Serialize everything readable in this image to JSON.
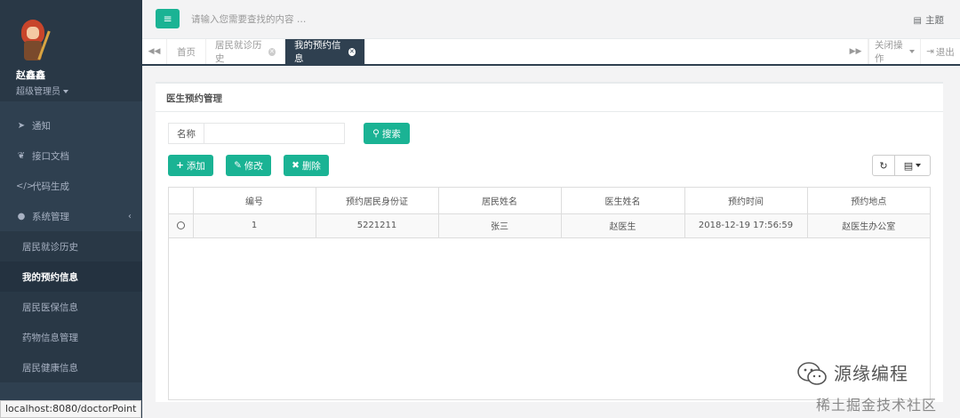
{
  "sidebar": {
    "profile": {
      "name": "赵鑫鑫",
      "role": "超级管理员"
    },
    "items": [
      {
        "icon": "paper-plane-icon",
        "glyph": "➤",
        "label": "通知"
      },
      {
        "icon": "leaf-icon",
        "glyph": "❦",
        "label": "接口文档"
      },
      {
        "icon": "code-icon",
        "glyph": "</>",
        "label": "代码生成"
      },
      {
        "icon": "user-icon",
        "glyph": "●",
        "label": "系统管理",
        "arrow": "‹"
      }
    ],
    "subitems": [
      "居民就诊历史",
      "我的预约信息",
      "居民医保信息",
      "药物信息管理",
      "居民健康信息"
    ],
    "active_sub": "我的预约信息"
  },
  "statusbar": {
    "url": "localhost:8080/doctorPoint"
  },
  "topbar": {
    "menu_icon": "≡",
    "search_placeholder": "请输入您需要查找的内容 …",
    "theme_icon": "▤",
    "theme_label": "主题"
  },
  "tabs": {
    "left_arrow": "◀◀",
    "right_arrow": "▶▶",
    "items": [
      "首页",
      "居民就诊历史",
      "我的预约信息"
    ],
    "active": "我的预约信息",
    "close_ops": "关闭操作",
    "logout": "退出",
    "logout_icon": "⇥"
  },
  "panel": {
    "title": "医生预约管理",
    "search": {
      "label": "名称",
      "value": "",
      "button": "搜索",
      "button_icon": "⚲"
    },
    "actions": [
      {
        "label": "添加",
        "glyph": "+"
      },
      {
        "label": "修改",
        "glyph": "✎"
      },
      {
        "label": "删除",
        "glyph": "✖"
      }
    ],
    "tools": {
      "refresh": "↻",
      "columns": "▤"
    }
  },
  "table": {
    "columns": [
      "编号",
      "预约居民身份证",
      "居民姓名",
      "医生姓名",
      "预约时间",
      "预约地点"
    ],
    "rows": [
      [
        "1",
        "5221211",
        "张三",
        "赵医生",
        "2018-12-19 17:56:59",
        "赵医生办公室"
      ]
    ]
  },
  "watermark": {
    "title": "源缘编程",
    "subtitle": "稀土掘金技术社区"
  }
}
